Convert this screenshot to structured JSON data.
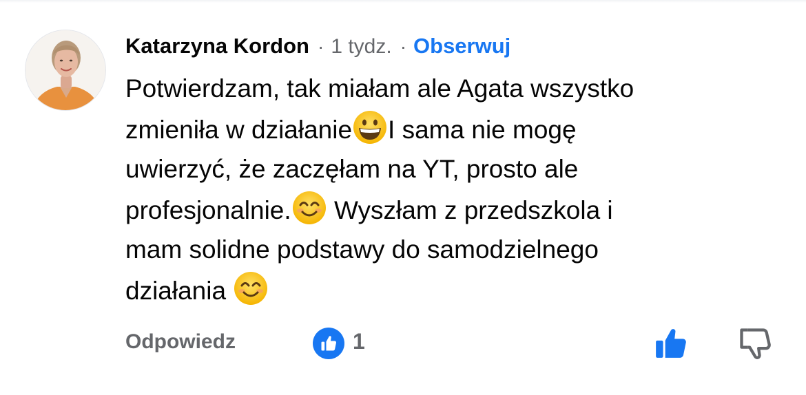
{
  "comment": {
    "author": "Katarzyna Kordon",
    "separator": "·",
    "time": "1 tydz.",
    "follow_label": "Obserwuj",
    "body_lines": [
      "Potwierdzam, tak miałam ale Agata wszystko",
      "zmieniła w działanie",
      "I sama nie mogę",
      "uwierzyć, że zaczęłam na YT, prosto ale",
      "profesjonalnie.",
      " Wyszłam z przedszkola i",
      "mam solidne podstawy do samodzielnego",
      "działania "
    ],
    "emojis": {
      "grin": "grinning-face-emoji",
      "smile": "smiling-face-with-smiling-eyes-emoji"
    }
  },
  "actions": {
    "reply_label": "Odpowiedz",
    "like_count": "1",
    "like_icon": "thumbs-up-icon",
    "dislike_icon": "thumbs-down-icon"
  },
  "colors": {
    "accent": "#1877f2",
    "secondary_text": "#65676b",
    "primary_text": "#050505",
    "avatar_shirt": "#e8913e"
  }
}
